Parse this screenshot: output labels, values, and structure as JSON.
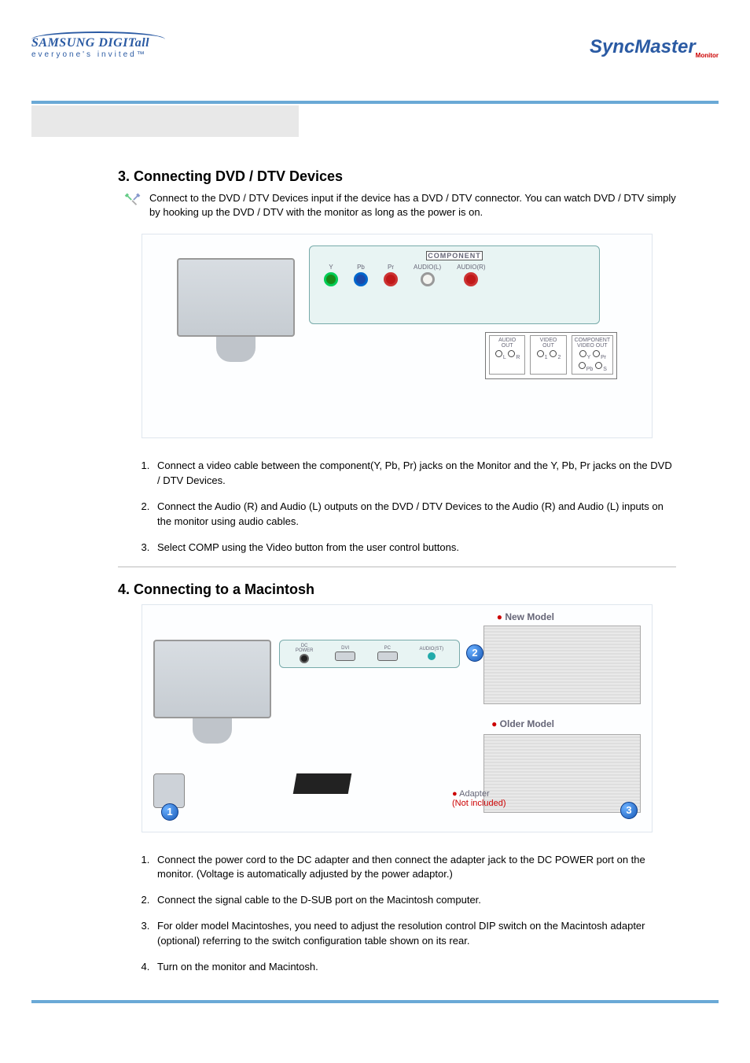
{
  "header": {
    "samsung_name": "SAMSUNG DIGITall",
    "samsung_tag": "everyone's invited™",
    "syncmaster": "SyncMaster",
    "syncmaster_sub": "Monitor"
  },
  "section3": {
    "heading": "3. Connecting DVD / DTV Devices",
    "intro": "Connect to the DVD / DTV Devices input if the device has a DVD / DTV connector. You can watch DVD / DTV simply by hooking up the DVD / DTV with the monitor as long as the power is on.",
    "diagram": {
      "panel_title": "COMPONENT",
      "jacks": [
        "Y",
        "Pb",
        "Pr",
        "AUDIO(L)",
        "AUDIO(R)"
      ],
      "dvd_outputs": {
        "audio_out": "AUDIO OUT",
        "video_out": "VIDEO OUT",
        "component_out": "COMPONENT VIDEO OUT",
        "audio_l": "L",
        "audio_r": "R",
        "v1": "1",
        "v2": "2",
        "cy": "Y",
        "cpb": "Pb",
        "cpr": "Pr",
        "cs": "S"
      }
    },
    "steps": [
      "Connect a video cable between the component(Y, Pb, Pr) jacks on the Monitor and the Y, Pb, Pr jacks on the DVD / DTV Devices.",
      "Connect the Audio (R) and Audio (L) outputs on the DVD / DTV Devices to the Audio (R) and Audio (L) inputs on the monitor using audio cables.",
      "Select COMP using the Video button from the user control buttons."
    ]
  },
  "section4": {
    "heading": "4. Connecting to a Macintosh",
    "diagram": {
      "ports": {
        "dc": "DC\nPOWER",
        "dvi": "DVI",
        "pc_group": "PC",
        "pc": "PC",
        "audio": "AUDIO(ST)"
      },
      "new_model": "New Model",
      "older_model": "Older Model",
      "adapter": "Adapter",
      "not_included": "(Not included)",
      "badges": {
        "b1": "1",
        "b2": "2",
        "b3": "3"
      }
    },
    "steps": [
      "Connect the power cord to the DC adapter and then connect the adapter jack to the DC POWER port on the monitor. (Voltage is automatically adjusted by the power adaptor.)",
      "Connect the signal cable to the D-SUB port on the Macintosh computer.",
      "For older model Macintoshes, you need to adjust the resolution control DIP switch on the Macintosh adapter (optional) referring to the switch configuration table shown on its rear.",
      "Turn on the monitor and Macintosh."
    ]
  }
}
